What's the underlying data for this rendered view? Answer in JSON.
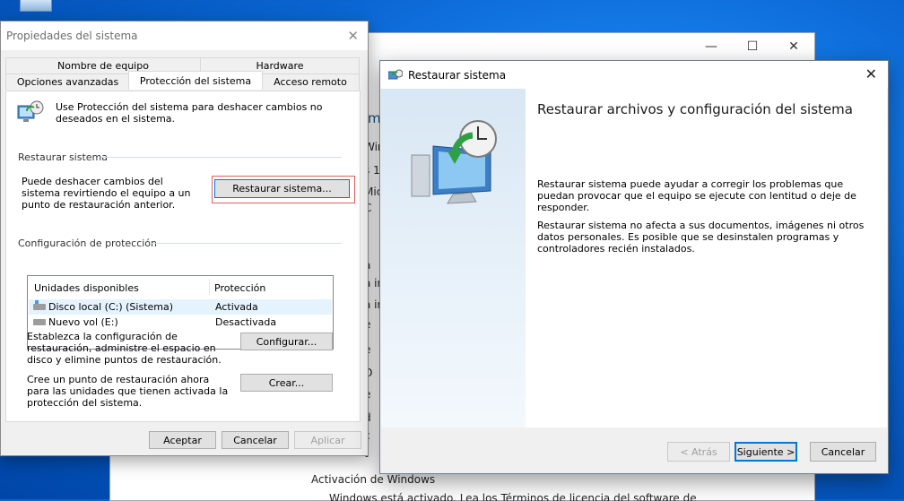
{
  "background_window": {
    "controls": [
      "—",
      "☐",
      "✕"
    ],
    "fragments": [
      "m",
      "Win",
      "s 1",
      "Mic",
      "C",
      "a",
      "a ir",
      "a ir",
      "e",
      "e",
      "O",
      "e",
      "d",
      "c",
      "t",
      "d",
      "t"
    ],
    "activation_label": "Activación de Windows",
    "activation_tail": "Windows está activado. Lea los Términos de licencia del software de Microsoft"
  },
  "system_properties": {
    "title": "Propiedades del sistema",
    "tabs": {
      "nombre_equipo": "Nombre de equipo",
      "hardware": "Hardware",
      "opciones_avanzadas": "Opciones avanzadas",
      "proteccion": "Protección del sistema",
      "acceso_remoto": "Acceso remoto"
    },
    "intro": "Use Protección del sistema para deshacer cambios no deseados en el sistema.",
    "restore_group": "Restaurar sistema",
    "restore_text": "Puede deshacer cambios del sistema revirtiendo el equipo a un punto de restauración anterior.",
    "restore_button": "Restaurar sistema...",
    "config_group": "Configuración de protección",
    "table": {
      "col_drives": "Unidades disponibles",
      "col_protection": "Protección",
      "rows": [
        {
          "drive": "Disco local (C:) (Sistema)",
          "status": "Activada"
        },
        {
          "drive": "Nuevo vol (E:)",
          "status": "Desactivada"
        }
      ]
    },
    "configure_text": "Establezca la configuración de restauración, administre el espacio en disco y elimine puntos de restauración.",
    "configure_button": "Configurar...",
    "create_text": "Cree un punto de restauración ahora para las unidades que tienen activada la protección del sistema.",
    "create_button": "Crear...",
    "ok": "Aceptar",
    "cancel": "Cancelar",
    "apply": "Aplicar"
  },
  "restore_wizard": {
    "title": "Restaurar sistema",
    "heading": "Restaurar archivos y configuración del sistema",
    "para1": "Restaurar sistema puede ayudar a corregir los problemas que puedan provocar que el equipo se ejecute con lentitud o deje de responder.",
    "para2": "Restaurar sistema no afecta a sus documentos, imágenes ni otros datos personales. Es posible que se desinstalen programas y controladores recién instalados.",
    "back": "< Atrás",
    "next": "Siguiente >",
    "cancel": "Cancelar"
  },
  "colors": {
    "accent": "#0078d7",
    "highlight_border": "#e06060",
    "desktop": "#0a64c8"
  }
}
